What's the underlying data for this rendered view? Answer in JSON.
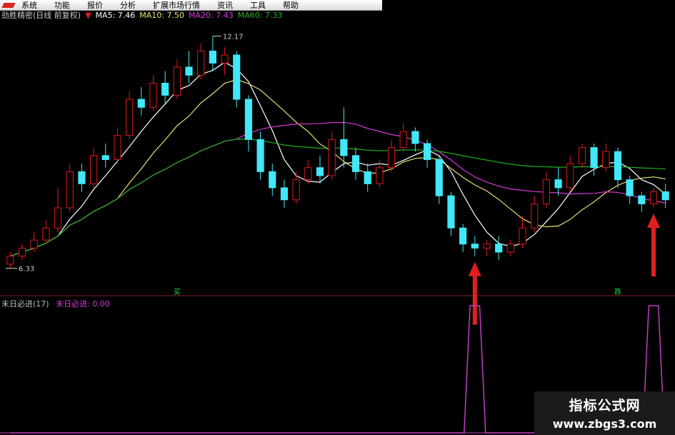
{
  "menu": {
    "items": [
      "系统",
      "功能",
      "报价",
      "分析",
      "扩展市场行情",
      "资讯",
      "工具",
      "帮助"
    ]
  },
  "info": {
    "title": "劲胜精密(日线 前复权)",
    "ma5": "MA5: 7.46",
    "ma10": "MA10: 7.50",
    "ma20": "MA20: 7.43",
    "ma60": "MA60: 7.33"
  },
  "indicator": {
    "name": "末日必进(17)",
    "value": "末日必进: 0.00"
  },
  "annotations": {
    "high": "12.17",
    "low": "6.33",
    "buy_sign_1": "买",
    "sell_sign_1": "跌"
  },
  "watermark": {
    "line1": "指标公式网",
    "line2": "www.zbgs3.com"
  },
  "colors": {
    "up": "#e01818",
    "down": "#40e8f8",
    "ma5": "#ffffff",
    "ma10": "#e8e070",
    "ma20": "#d838d8",
    "ma60": "#20b020",
    "indicator": "#c040c0",
    "arrow": "#e02020"
  },
  "chart_data": [
    {
      "type": "candlestick",
      "title": "劲胜精密(日线 前复权)",
      "price_range": [
        6.0,
        12.5
      ],
      "candles": [
        [
          6.5,
          6.7,
          6.4,
          6.8
        ],
        [
          6.7,
          6.9,
          6.6,
          7.0
        ],
        [
          6.9,
          7.1,
          6.8,
          7.3
        ],
        [
          7.1,
          7.4,
          7.0,
          7.6
        ],
        [
          7.4,
          7.9,
          7.3,
          8.4
        ],
        [
          7.9,
          8.8,
          7.8,
          9.0
        ],
        [
          8.8,
          8.5,
          8.3,
          9.0
        ],
        [
          8.5,
          9.2,
          8.4,
          9.4
        ],
        [
          9.2,
          9.1,
          8.9,
          9.5
        ],
        [
          9.1,
          9.7,
          9.0,
          9.9
        ],
        [
          9.7,
          10.6,
          9.6,
          10.8
        ],
        [
          10.6,
          10.4,
          10.2,
          10.9
        ],
        [
          10.4,
          11.0,
          10.3,
          11.2
        ],
        [
          11.0,
          10.7,
          10.5,
          11.3
        ],
        [
          10.7,
          11.4,
          10.6,
          11.6
        ],
        [
          11.4,
          11.2,
          11.0,
          11.8
        ],
        [
          11.2,
          11.8,
          11.1,
          12.0
        ],
        [
          11.8,
          11.5,
          11.3,
          12.17
        ],
        [
          11.5,
          11.7,
          11.2,
          11.9
        ],
        [
          11.7,
          10.6,
          10.4,
          11.8
        ],
        [
          10.6,
          9.6,
          9.3,
          10.7
        ],
        [
          9.6,
          8.8,
          8.6,
          9.8
        ],
        [
          8.8,
          8.4,
          8.2,
          9.0
        ],
        [
          8.4,
          8.1,
          7.9,
          8.6
        ],
        [
          8.1,
          8.6,
          8.0,
          8.8
        ],
        [
          8.6,
          8.9,
          8.5,
          9.1
        ],
        [
          8.9,
          8.7,
          8.5,
          9.2
        ],
        [
          8.7,
          9.6,
          8.6,
          9.8
        ],
        [
          9.6,
          9.2,
          8.9,
          10.4
        ],
        [
          9.2,
          8.8,
          8.6,
          9.4
        ],
        [
          8.8,
          8.5,
          8.3,
          9.0
        ],
        [
          8.5,
          8.9,
          8.4,
          9.1
        ],
        [
          8.9,
          9.4,
          8.8,
          9.6
        ],
        [
          9.4,
          9.8,
          9.3,
          10.0
        ],
        [
          9.8,
          9.5,
          9.3,
          9.9
        ],
        [
          9.5,
          9.1,
          8.9,
          9.6
        ],
        [
          9.1,
          8.2,
          8.0,
          9.2
        ],
        [
          8.2,
          7.4,
          7.2,
          8.3
        ],
        [
          7.4,
          7.0,
          6.8,
          7.5
        ],
        [
          7.0,
          6.9,
          6.7,
          7.2
        ],
        [
          6.9,
          7.0,
          6.7,
          7.1
        ],
        [
          7.0,
          6.8,
          6.6,
          7.2
        ],
        [
          6.8,
          7.0,
          6.7,
          7.1
        ],
        [
          7.0,
          7.4,
          6.9,
          7.7
        ],
        [
          7.4,
          8.0,
          7.3,
          8.2
        ],
        [
          8.0,
          8.6,
          7.9,
          8.8
        ],
        [
          8.6,
          8.4,
          8.2,
          8.9
        ],
        [
          8.4,
          9.0,
          8.3,
          9.2
        ],
        [
          9.0,
          9.4,
          8.9,
          9.5
        ],
        [
          9.4,
          8.9,
          8.7,
          9.5
        ],
        [
          8.9,
          9.3,
          8.8,
          9.5
        ],
        [
          9.3,
          8.6,
          8.4,
          9.4
        ],
        [
          8.6,
          8.2,
          8.0,
          8.7
        ],
        [
          8.2,
          8.0,
          7.8,
          8.3
        ],
        [
          8.0,
          8.3,
          7.9,
          8.4
        ],
        [
          8.3,
          8.1,
          7.9,
          8.5
        ]
      ],
      "series": [
        {
          "name": "MA5",
          "value": 7.46
        },
        {
          "name": "MA10",
          "value": 7.5
        },
        {
          "name": "MA20",
          "value": 7.43
        },
        {
          "name": "MA60",
          "value": 7.33
        }
      ],
      "annotations": [
        {
          "text": "12.17",
          "kind": "max price"
        },
        {
          "text": "6.33",
          "kind": "min price"
        }
      ]
    },
    {
      "type": "line",
      "title": "末日必进(17)",
      "series": [
        {
          "name": "末日必进",
          "value": 0.0
        }
      ],
      "signals": [
        {
          "bar_index": 39,
          "value": 1
        },
        {
          "bar_index": 54,
          "value": 1
        }
      ]
    }
  ]
}
